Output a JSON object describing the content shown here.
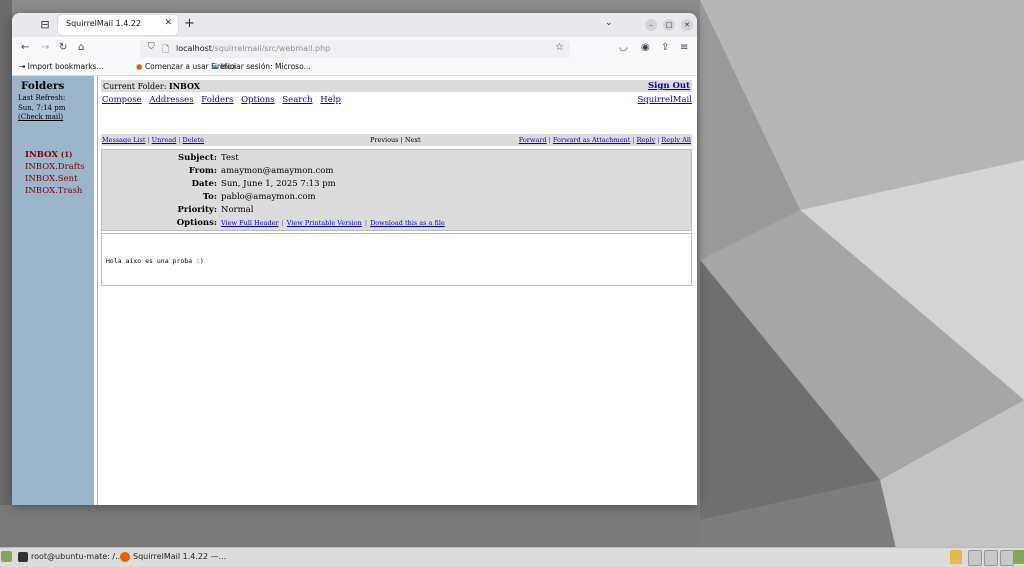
{
  "browser": {
    "tab_title": "SquirrelMail 1.4.22",
    "url_host": "localhost",
    "url_path": "/squirrelmail/src/webmail.php",
    "bookmarks": [
      "Import bookmarks...",
      "Comenzar a usar Firefox",
      "Iniciar sesión: Microso..."
    ]
  },
  "sidebar": {
    "title": "Folders",
    "last_refresh_label": "Last Refresh:",
    "last_refresh_time": "Sun, 7:14 pm",
    "check_mail": "(Check mail)",
    "folders": [
      {
        "name": "INBOX",
        "count": "(1)"
      },
      {
        "name": "INBOX.Drafts"
      },
      {
        "name": "INBOX.Sent"
      },
      {
        "name": "INBOX.Trash"
      }
    ]
  },
  "main": {
    "current_folder_label": "Current Folder:",
    "current_folder": "INBOX",
    "sign_out": "Sign Out",
    "menu": [
      "Compose",
      "Addresses",
      "Folders",
      "Options",
      "Search",
      "Help"
    ],
    "squirrelmail_link": "SquirrelMail",
    "actions_left": [
      "Message List",
      "Unread",
      "Delete"
    ],
    "actions_mid": "Previous | Next",
    "actions_right": [
      "Forward",
      "Forward as Attachment",
      "Reply",
      "Reply All"
    ],
    "headers": {
      "subject_label": "Subject:",
      "subject": "Test",
      "from_label": "From:",
      "from": "amaymon@amaymon.com",
      "date_label": "Date:",
      "date": "Sun, June 1, 2025 7:13 pm",
      "to_label": "To:",
      "to": "pablo@amaymon.com",
      "priority_label": "Priority:",
      "priority": "Normal",
      "options_label": "Options:",
      "options": [
        "View Full Header",
        "View Printable Version",
        "Download this as a file"
      ]
    },
    "body": "Hola aixo es una proba :)"
  },
  "taskbar": {
    "items": [
      "root@ubuntu-mate: /...",
      "SquirrelMail 1.4.22 —..."
    ]
  }
}
